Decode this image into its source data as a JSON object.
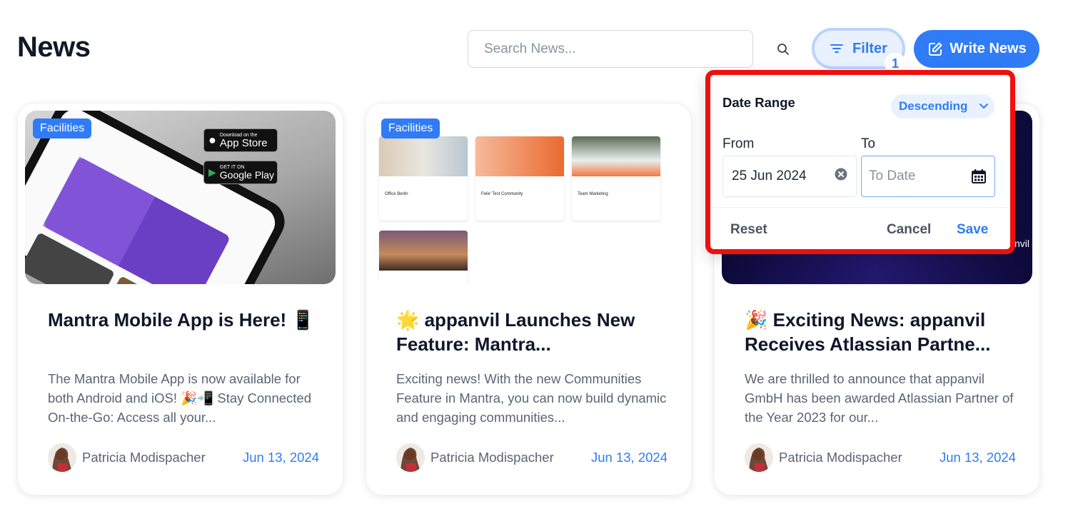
{
  "header": {
    "title": "News",
    "search_placeholder": "Search News...",
    "filter_label": "Filter",
    "filter_count": "1",
    "write_label": "Write News"
  },
  "colors": {
    "accent": "#2f7cf6",
    "accent_light": "#eaf1fe",
    "highlight_border": "#ef0f0f"
  },
  "filter_popup": {
    "title": "Date Range",
    "sort_value": "Descending",
    "from_label": "From",
    "to_label": "To",
    "from_value": "25 Jun 2024",
    "to_placeholder": "To Date",
    "reset_label": "Reset",
    "cancel_label": "Cancel",
    "save_label": "Save"
  },
  "cards": [
    {
      "tag": "Facilities",
      "title": "Mantra Mobile App is Here! 📱",
      "excerpt": "The Mantra Mobile App is now available for both Android and iOS! 🎉📲 Stay Connected On-the-Go: Access all your...",
      "author": "Patricia Modispacher",
      "date": "Jun 13, 2024",
      "image_text": {
        "app_store_small": "Download on the",
        "app_store_big": "App Store",
        "play_small": "GET IT ON",
        "play_big": "Google Play"
      }
    },
    {
      "tag": "Facilities",
      "title": "🌟 appanvil Launches New Feature: Mantra...",
      "excerpt": "Exciting news! With the new Communities Feature in Mantra, you can now build dynamic and engaging communities...",
      "author": "Patricia Modispacher",
      "date": "Jun 13, 2024",
      "image_text": {
        "c1": "Office Berlin",
        "c2": "Felix' Test Community",
        "c3": "Team Marketing"
      }
    },
    {
      "tag": "",
      "title": "🎉 Exciting News: appanvil Receives Atlassian Partne...",
      "excerpt": "We are thrilled to announce that appanvil GmbH has been awarded Atlassian Partner of the Year 2023 for our...",
      "author": "Patricia Modispacher",
      "date": "Jun 13, 2024",
      "image_text": {
        "brand": "nvil"
      }
    }
  ]
}
